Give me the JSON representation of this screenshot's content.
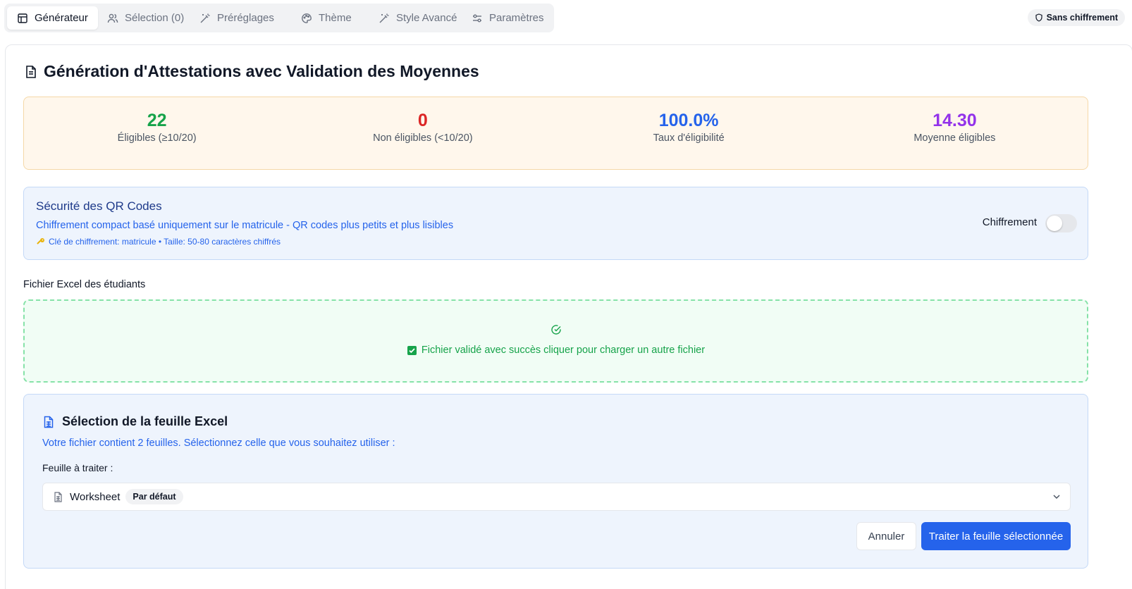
{
  "tabs": [
    {
      "label": "Générateur",
      "icon": "table-icon",
      "active": true
    },
    {
      "label": "Sélection (0)",
      "icon": "users-icon",
      "active": false
    },
    {
      "label": "Préréglages",
      "icon": "wand-icon",
      "active": false
    },
    {
      "label": "Thème",
      "icon": "palette-icon",
      "active": false
    },
    {
      "label": "Style Avancé",
      "icon": "wand-icon",
      "active": false
    },
    {
      "label": "Paramètres",
      "icon": "sliders-icon",
      "active": false
    }
  ],
  "encryption_badge": {
    "label": "Sans chiffrement",
    "icon": "shield-icon"
  },
  "page_title": "Génération d'Attestations avec Validation des Moyennes",
  "stats": [
    {
      "value": "22",
      "label": "Éligibles (≥10/20)",
      "color": "#16a34a"
    },
    {
      "value": "0",
      "label": "Non éligibles (<10/20)",
      "color": "#dc2626"
    },
    {
      "value": "100.0%",
      "label": "Taux d'éligibilité",
      "color": "#2563eb"
    },
    {
      "value": "14.30",
      "label": "Moyenne éligibles",
      "color": "#9333ea"
    }
  ],
  "security": {
    "title": "Sécurité des QR Codes",
    "description": "Chiffrement compact basé uniquement sur le matricule - QR codes plus petits et plus lisibles",
    "note": "Clé de chiffrement: matricule • Taille: 50-80 caractères chiffrés",
    "note_icon": "key-icon",
    "toggle_label": "Chiffrement",
    "toggle_on": false
  },
  "file": {
    "label": "Fichier Excel des étudiants",
    "status_icon": "check-circle-icon",
    "status_text": "Fichier validé avec succès cliquer pour charger un autre fichier"
  },
  "sheet_selection": {
    "title": "Sélection de la feuille Excel",
    "description": "Votre fichier contient 2 feuilles. Sélectionnez celle que vous souhaitez utiliser :",
    "field_label": "Feuille à traiter :",
    "selected_value": "Worksheet",
    "selected_badge": "Par défaut",
    "cancel_label": "Annuler",
    "submit_label": "Traiter la feuille sélectionnée"
  },
  "colors": {
    "accent": "#2563eb",
    "success": "#16a34a",
    "danger": "#dc2626",
    "purple": "#9333ea"
  }
}
